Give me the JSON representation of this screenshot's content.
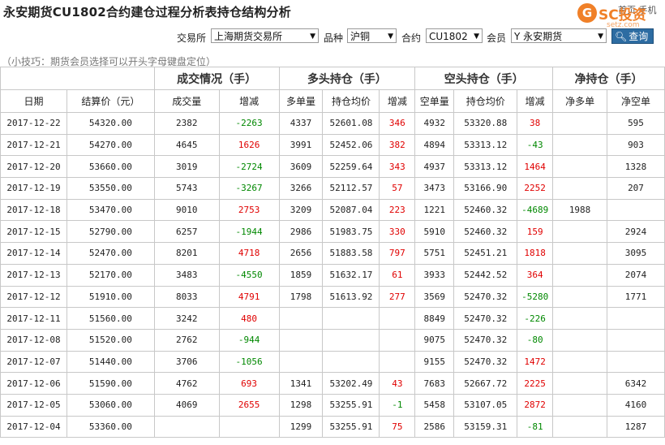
{
  "page_title": "永安期货CU1802合约建仓过程分析表持仓结构分析",
  "corner_text": "首页  手机",
  "logo": {
    "mark": "G",
    "brand": "SC投资",
    "domain": "setz.com"
  },
  "filters": {
    "exchange_label": "交易所",
    "exchange_value": "上海期货交易所",
    "product_label": "品种",
    "product_value": "沪铜",
    "contract_label": "合约",
    "contract_value": "CU1802",
    "member_label": "会员",
    "member_value": "Y 永安期货",
    "query_label": "查询"
  },
  "tip": "（小技巧：期货会员选择可以开头字母键盘定位）",
  "group_headers": [
    "成交情况（手）",
    "多头持仓（手）",
    "空头持仓（手）",
    "净持仓（手）"
  ],
  "columns": [
    "日期",
    "结算价（元）",
    "成交量",
    "增减",
    "多单量",
    "持仓均价",
    "增减",
    "空单量",
    "持仓均价",
    "增减",
    "净多单",
    "净空单"
  ],
  "colors": {
    "up": "#e00000",
    "down": "#008800",
    "query_button": "#2d6ca2",
    "logo": "#f08028"
  },
  "rows": [
    [
      "2017-12-22",
      "54320.00",
      "2382",
      "-2263",
      "4337",
      "52601.08",
      "346",
      "4932",
      "53320.88",
      "38",
      "",
      "595"
    ],
    [
      "2017-12-21",
      "54270.00",
      "4645",
      "1626",
      "3991",
      "52452.06",
      "382",
      "4894",
      "53313.12",
      "-43",
      "",
      "903"
    ],
    [
      "2017-12-20",
      "53660.00",
      "3019",
      "-2724",
      "3609",
      "52259.64",
      "343",
      "4937",
      "53313.12",
      "1464",
      "",
      "1328"
    ],
    [
      "2017-12-19",
      "53550.00",
      "5743",
      "-3267",
      "3266",
      "52112.57",
      "57",
      "3473",
      "53166.90",
      "2252",
      "",
      "207"
    ],
    [
      "2017-12-18",
      "53470.00",
      "9010",
      "2753",
      "3209",
      "52087.04",
      "223",
      "1221",
      "52460.32",
      "-4689",
      "1988",
      ""
    ],
    [
      "2017-12-15",
      "52790.00",
      "6257",
      "-1944",
      "2986",
      "51983.75",
      "330",
      "5910",
      "52460.32",
      "159",
      "",
      "2924"
    ],
    [
      "2017-12-14",
      "52470.00",
      "8201",
      "4718",
      "2656",
      "51883.58",
      "797",
      "5751",
      "52451.21",
      "1818",
      "",
      "3095"
    ],
    [
      "2017-12-13",
      "52170.00",
      "3483",
      "-4550",
      "1859",
      "51632.17",
      "61",
      "3933",
      "52442.52",
      "364",
      "",
      "2074"
    ],
    [
      "2017-12-12",
      "51910.00",
      "8033",
      "4791",
      "1798",
      "51613.92",
      "277",
      "3569",
      "52470.32",
      "-5280",
      "",
      "1771"
    ],
    [
      "2017-12-11",
      "51560.00",
      "3242",
      "480",
      "",
      "",
      "",
      "8849",
      "52470.32",
      "-226",
      "",
      ""
    ],
    [
      "2017-12-08",
      "51520.00",
      "2762",
      "-944",
      "",
      "",
      "",
      "9075",
      "52470.32",
      "-80",
      "",
      ""
    ],
    [
      "2017-12-07",
      "51440.00",
      "3706",
      "-1056",
      "",
      "",
      "",
      "9155",
      "52470.32",
      "1472",
      "",
      ""
    ],
    [
      "2017-12-06",
      "51590.00",
      "4762",
      "693",
      "1341",
      "53202.49",
      "43",
      "7683",
      "52667.72",
      "2225",
      "",
      "6342"
    ],
    [
      "2017-12-05",
      "53060.00",
      "4069",
      "2655",
      "1298",
      "53255.91",
      "-1",
      "5458",
      "53107.05",
      "2872",
      "",
      "4160"
    ],
    [
      "2017-12-04",
      "53360.00",
      "",
      "",
      "1299",
      "53255.91",
      "75",
      "2586",
      "53159.31",
      "-81",
      "",
      "1287"
    ]
  ]
}
